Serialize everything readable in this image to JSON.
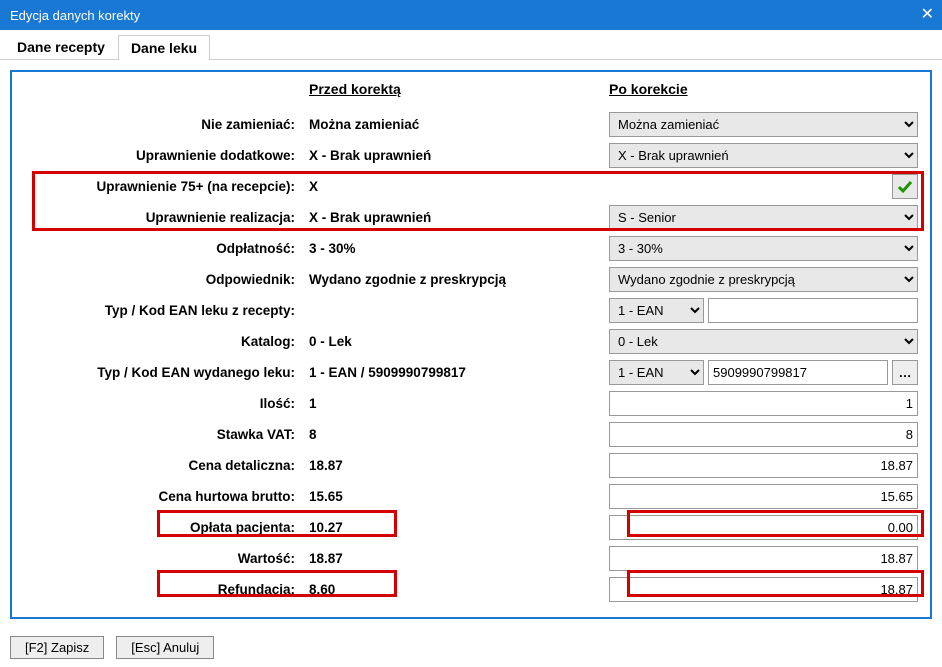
{
  "window": {
    "title": "Edycja danych korekty"
  },
  "tabs": [
    {
      "label": "Dane recepty",
      "active": false
    },
    {
      "label": "Dane leku",
      "active": true
    }
  ],
  "headers": {
    "before": "Przed korektą",
    "after": "Po korekcie"
  },
  "rows": {
    "nie_zamieniac": {
      "label": "Nie zamieniać:",
      "before": "Można zamieniać",
      "after": "Można zamieniać"
    },
    "upr_dodatkowe": {
      "label": "Uprawnienie dodatkowe:",
      "before": "X - Brak uprawnień",
      "after": "X - Brak uprawnień"
    },
    "upr_75": {
      "label": "Uprawnienie 75+ (na recepcie):",
      "before": "X",
      "after_check": true
    },
    "upr_realizacja": {
      "label": "Uprawnienie realizacja:",
      "before": "X - Brak uprawnień",
      "after": "S - Senior"
    },
    "odplatnosc": {
      "label": "Odpłatność:",
      "before": "3 - 30%",
      "after": "3 - 30%"
    },
    "odpowiednik": {
      "label": "Odpowiednik:",
      "before": "Wydano zgodnie z preskrypcją",
      "after": "Wydano zgodnie z preskrypcją"
    },
    "typ_ean_recepty": {
      "label": "Typ / Kod EAN leku z recepty:",
      "before": "",
      "after_type": "1 - EAN",
      "after_code": ""
    },
    "katalog": {
      "label": "Katalog:",
      "before": "0 - Lek",
      "after": "0 - Lek"
    },
    "typ_ean_wydany": {
      "label": "Typ / Kod EAN wydanego leku:",
      "before": "1 - EAN / 5909990799817",
      "after_type": "1 - EAN",
      "after_code": "5909990799817"
    },
    "ilosc": {
      "label": "Ilość:",
      "before": "1",
      "after": "1"
    },
    "vat": {
      "label": "Stawka VAT:",
      "before": "8",
      "after": "8"
    },
    "cena_det": {
      "label": "Cena detaliczna:",
      "before": "18.87",
      "after": "18.87"
    },
    "cena_hurt": {
      "label": "Cena hurtowa brutto:",
      "before": "15.65",
      "after": "15.65"
    },
    "oplata": {
      "label": "Opłata pacjenta:",
      "before": "10.27",
      "after": "0.00"
    },
    "wartosc": {
      "label": "Wartość:",
      "before": "18.87",
      "after": "18.87"
    },
    "refundacja": {
      "label": "Refundacja:",
      "before": "8.60",
      "after": "18.87"
    }
  },
  "footer": {
    "save": "[F2] Zapisz",
    "cancel": "[Esc] Anuluj"
  }
}
